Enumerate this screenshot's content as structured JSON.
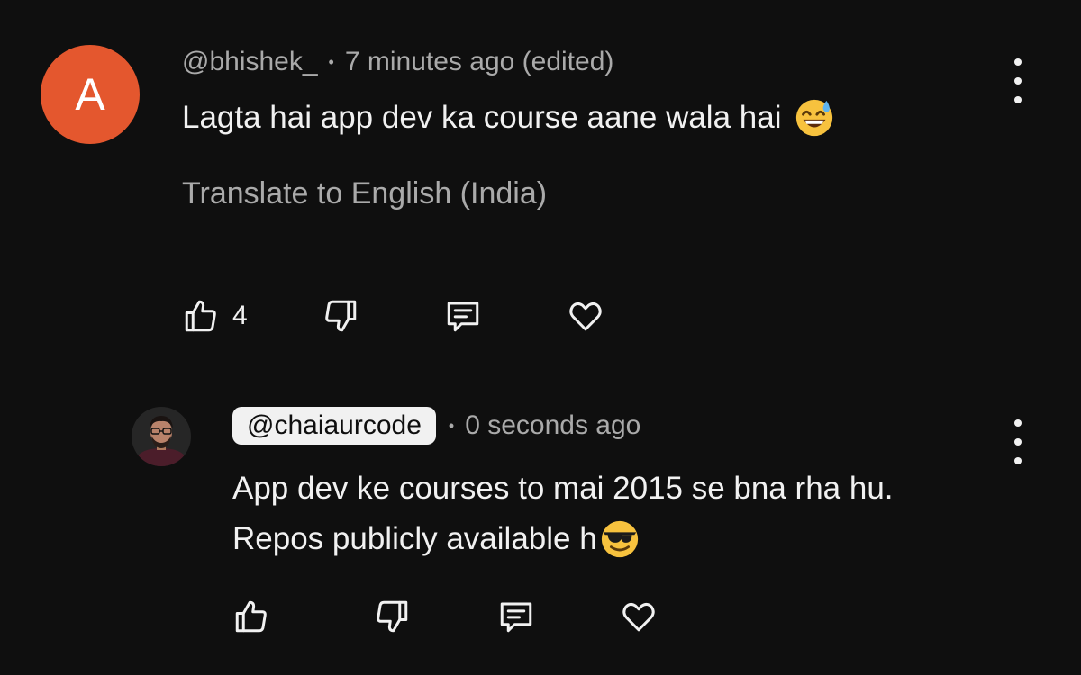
{
  "comment": {
    "avatar_letter": "A",
    "avatar_color": "#e4572e",
    "author": "@bhishek_",
    "separator": "•",
    "time": "7 minutes ago (edited)",
    "text": "Lagta hai app dev ka course aane wala hai",
    "emoji": "grinning-face-with-sweat",
    "translate_label": "Translate to English (India)",
    "like_count": "4",
    "icons": [
      "thumbs-up-icon",
      "thumbs-down-icon",
      "reply-icon",
      "heart-icon",
      "more-vert-icon"
    ]
  },
  "reply": {
    "author": "@chaiaurcode",
    "separator": "•",
    "time": "0 seconds ago",
    "text_line1": "App dev ke courses to mai 2015 se bna rha hu.",
    "text_line2": "Repos publicly available h",
    "emoji": "smiling-face-with-sunglasses",
    "icons": [
      "thumbs-up-icon",
      "thumbs-down-icon",
      "reply-icon",
      "heart-icon",
      "more-vert-icon"
    ]
  },
  "colors": {
    "background": "#0f0f0f",
    "primary_text": "#f1f1f1",
    "secondary_text": "#aaaaaa",
    "handle_pill": "#f1f1f1"
  }
}
